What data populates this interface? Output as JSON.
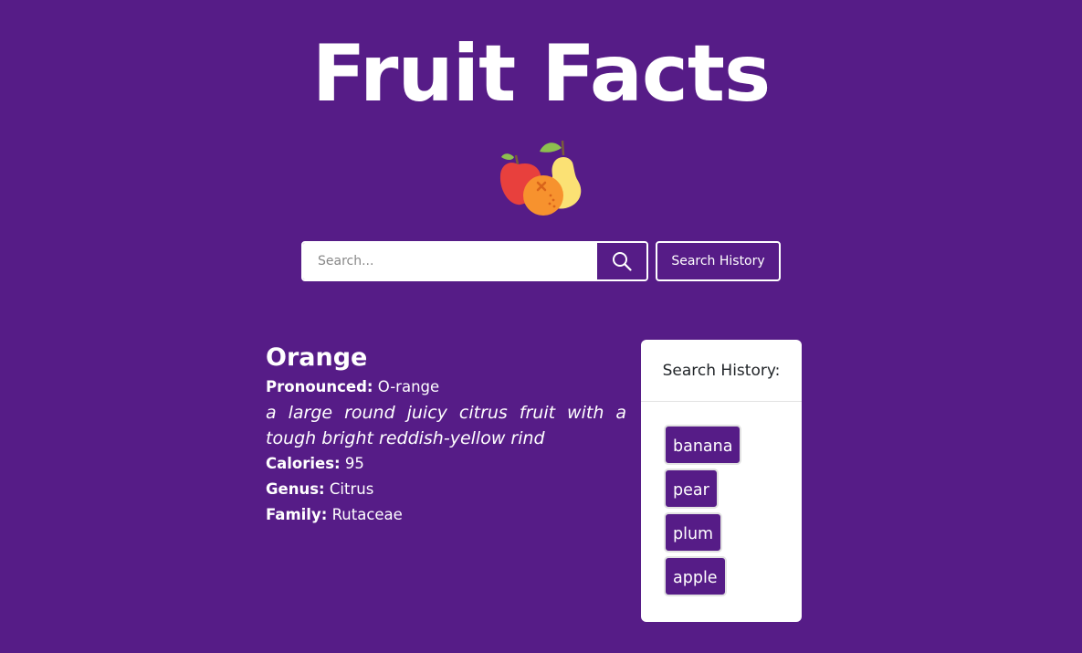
{
  "header": {
    "title": "Fruit Facts",
    "logo_icon": "fruit-basket-icon"
  },
  "search": {
    "placeholder": "Search...",
    "value": "",
    "submit_icon": "search-icon",
    "history_button_label": "Search History"
  },
  "fruit": {
    "name": "Orange",
    "pronounced_label": "Pronounced:",
    "pronounced_value": "O-range",
    "description": "a large round juicy citrus fruit with a tough bright reddish-yellow rind",
    "calories_label": "Calories:",
    "calories_value": "95",
    "genus_label": "Genus:",
    "genus_value": "Citrus",
    "family_label": "Family:",
    "family_value": "Rutaceae"
  },
  "history": {
    "title": "Search History:",
    "items": [
      "banana",
      "pear",
      "plum",
      "apple"
    ]
  },
  "colors": {
    "background": "#561c87",
    "card": "#ffffff",
    "apple": "#e8403d",
    "orange": "#f7922e",
    "pear": "#fbe174"
  }
}
